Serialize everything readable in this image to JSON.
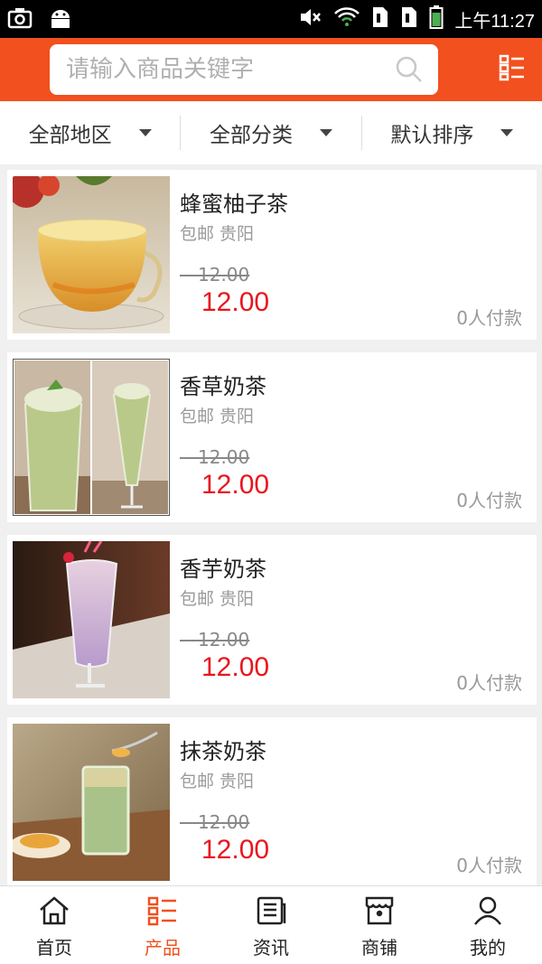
{
  "status_bar": {
    "time": "上午11:27"
  },
  "header": {
    "search_placeholder": "请输入商品关键字"
  },
  "filters": [
    {
      "label": "全部地区"
    },
    {
      "label": "全部分类"
    },
    {
      "label": "默认排序"
    }
  ],
  "products": [
    {
      "title": "蜂蜜柚子茶",
      "shipping": "包邮 贵阳",
      "old_price": "12.00",
      "price": "12.00",
      "sold": "0人付款"
    },
    {
      "title": "香草奶茶",
      "shipping": "包邮 贵阳",
      "old_price": "12.00",
      "price": "12.00",
      "sold": "0人付款"
    },
    {
      "title": "香芋奶茶",
      "shipping": "包邮 贵阳",
      "old_price": "12.00",
      "price": "12.00",
      "sold": "0人付款"
    },
    {
      "title": "抹茶奶茶",
      "shipping": "包邮 贵阳",
      "old_price": "12.00",
      "price": "12.00",
      "sold": "0人付款"
    }
  ],
  "bottom_nav": [
    {
      "label": "首页",
      "icon": "home-icon",
      "active": false
    },
    {
      "label": "产品",
      "icon": "product-list-icon",
      "active": true
    },
    {
      "label": "资讯",
      "icon": "news-icon",
      "active": false
    },
    {
      "label": "商铺",
      "icon": "store-icon",
      "active": false
    },
    {
      "label": "我的",
      "icon": "user-icon",
      "active": false
    }
  ],
  "colors": {
    "brand": "#f2501e",
    "price": "#e8161d",
    "background": "#f0f0f0"
  }
}
